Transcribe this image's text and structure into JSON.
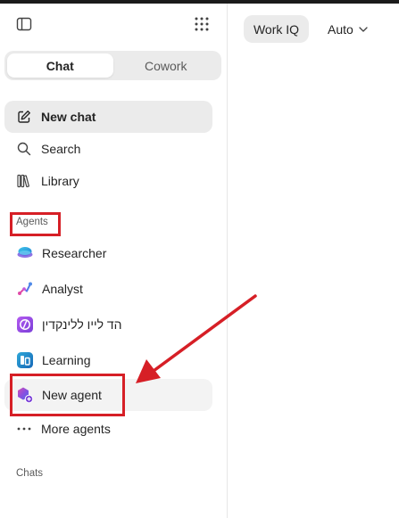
{
  "sidebar": {
    "tabs": [
      {
        "label": "Chat",
        "active": true
      },
      {
        "label": "Cowork",
        "active": false
      }
    ],
    "nav": {
      "new_chat": "New chat",
      "search": "Search",
      "library": "Library"
    },
    "agents_label": "Agents",
    "agents": [
      {
        "label": "Researcher",
        "icon": "researcher-icon"
      },
      {
        "label": "Analyst",
        "icon": "analyst-icon"
      },
      {
        "label": "הד לייו ללינקדין",
        "icon": "custom-agent-icon"
      },
      {
        "label": "Learning",
        "icon": "learning-icon"
      }
    ],
    "new_agent": "New agent",
    "more_agents": "More agents",
    "chats_label": "Chats"
  },
  "header": {
    "work_iq": "Work IQ",
    "mode": "Auto"
  },
  "annotation": {
    "color": "#d61f26"
  }
}
